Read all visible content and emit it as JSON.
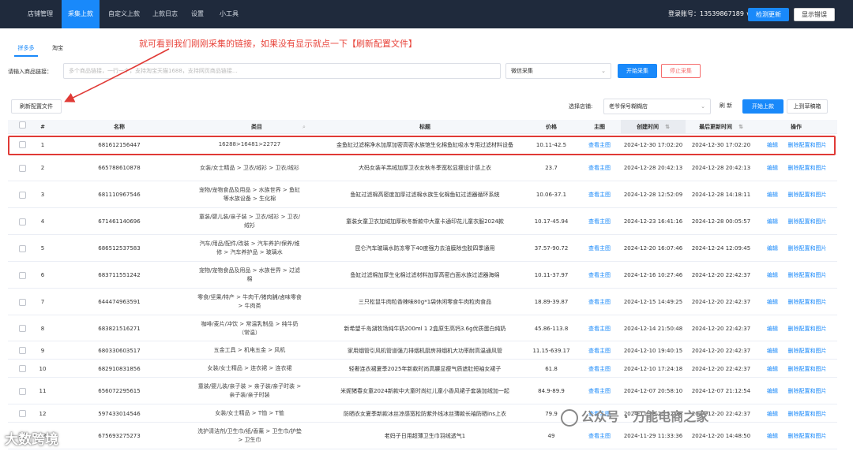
{
  "topnav": {
    "items": [
      "店铺管理",
      "采集上款",
      "自定义上款",
      "上款日志",
      "设置",
      "小工具"
    ],
    "account_label": "登录账号：13539867189 ∨",
    "refresh_btn": "检测更新",
    "login_btn": "显示错误"
  },
  "platform_tabs": [
    "拼多多",
    "淘宝"
  ],
  "annotation": "就可看到我们刚刚采集的链接，如果没有显示就点一下【刷新配置文件】",
  "collect": {
    "label": "请输入商品链接：",
    "placeholder": "多个商品链接，一行一个，支持淘宝天猫1688，支持网页商品链接…",
    "mode": "微信采集",
    "start_btn": "开始采集",
    "stop_btn": "停止采集"
  },
  "toolbar": {
    "refresh_config_btn": "刷新配置文件",
    "store_label": "选择店铺:",
    "store_value": "老爷保号糊糊店",
    "refresh_btn": "刷 新",
    "start_upload_btn": "开始上款",
    "upload_draft_btn": "上到草稿箱"
  },
  "table": {
    "headers": [
      "#",
      "名称",
      "类目",
      "标题",
      "价格",
      "主图",
      "创建时间",
      "最后更新时间",
      "操作"
    ],
    "rows": [
      {
        "no": "1",
        "name": "681612156447",
        "category": "16288>16481>22727",
        "title": "金鱼缸过滤棉净水加厚加密高密水族馆生化棉鱼缸吸水专用过滤材料设备",
        "price": "10.11-42.5",
        "image": "查看主图",
        "created": "2024-12-30 17:02:20",
        "updated": "2024-12-30 17:02:20",
        "edit": "编辑",
        "delete": "删除配置和图片"
      },
      {
        "no": "2",
        "name": "665788610878",
        "category": "女装/女士精品 > 卫衣/绒衫 > 卫衣/绒衫",
        "title": "大码女装羊羔绒加厚卫衣女秋冬季宽松显瘦设计感上衣",
        "price": "23.7",
        "image": "查看主图",
        "created": "2024-12-28 20:42:13",
        "updated": "2024-12-28 20:42:13",
        "edit": "编辑",
        "delete": "删除配置和图片"
      },
      {
        "no": "3",
        "name": "681110967546",
        "category": "宠物/宠物食品及用品 > 水族世界 > 鱼缸等水族设备 > 生化棉",
        "title": "鱼缸过滤棉高密度加厚过滤棉水族生化棉鱼缸过滤器循环系统",
        "price": "10.06-37.1",
        "image": "查看主图",
        "created": "2024-12-28 12:52:09",
        "updated": "2024-12-28 14:18:11",
        "edit": "编辑",
        "delete": "删除配置和图片"
      },
      {
        "no": "4",
        "name": "671461140696",
        "category": "童装/婴儿装/亲子装 > 卫衣/绒衫 > 卫衣/绒衫",
        "title": "童装女童卫衣加绒加厚秋冬新款中大童卡通印花儿童衣服2024款",
        "price": "10.17-45.94",
        "image": "查看主图",
        "created": "2024-12-23 16:41:16",
        "updated": "2024-12-28 00:05:57",
        "edit": "编辑",
        "delete": "删除配置和图片"
      },
      {
        "no": "5",
        "name": "686512537583",
        "category": "汽车/用品/配件/改装 > 汽车养护/保养/维修 > 汽车养护品 > 玻璃水",
        "title": "昆仑汽车玻璃水防冻零下40度强力去油膜除虫胶四季通用",
        "price": "37.57-90.72",
        "image": "查看主图",
        "created": "2024-12-20 16:07:46",
        "updated": "2024-12-24 12:09:45",
        "edit": "编辑",
        "delete": "删除配置和图片"
      },
      {
        "no": "6",
        "name": "683711551242",
        "category": "宠物/宠物食品及用品 > 水族世界 > 过滤棉",
        "title": "鱼缸过滤棉加厚生化棉过滤材料加厚高密白面水族过滤器海绵",
        "price": "10.11-37.97",
        "image": "查看主图",
        "created": "2024-12-16 10:27:46",
        "updated": "2024-12-20 22:42:37",
        "edit": "编辑",
        "delete": "删除配置和图片"
      },
      {
        "no": "7",
        "name": "644474963591",
        "category": "零食/坚果/特产 > 牛肉干/猪肉脯/卤味零食 > 牛肉类",
        "title": "三只松鼠牛肉粒香辣味80g*1袋休闲零食牛肉粒肉食品",
        "price": "18.89-39.87",
        "image": "查看主图",
        "created": "2024-12-15 14:49:25",
        "updated": "2024-12-20 22:42:37",
        "edit": "编辑",
        "delete": "删除配置和图片"
      },
      {
        "no": "8",
        "name": "683821516271",
        "category": "咖啡/麦片/冲饮 > 常温乳制品 > 纯牛奶（常温）",
        "title": "新希望千岛湖牧场纯牛奶200ml 1 2盒原生高钙3.6g优质蛋白纯奶",
        "price": "45.86-113.8",
        "image": "查看主图",
        "created": "2024-12-14 21:50:48",
        "updated": "2024-12-20 22:42:37",
        "edit": "编辑",
        "delete": "删除配置和图片"
      },
      {
        "no": "9",
        "name": "680330603517",
        "category": "五金工具 > 机电五金 > 风机",
        "title": "家用烟管引风机管道强力排烟机厨房排烟机大功率耐高温通风管",
        "price": "11.15-639.17",
        "image": "查看主图",
        "created": "2024-12-10 19:40:15",
        "updated": "2024-12-20 22:42:37",
        "edit": "编辑",
        "delete": "删除配置和图片"
      },
      {
        "no": "10",
        "name": "682910831856",
        "category": "女装/女士精品 > 连衣裙 > 连衣裙",
        "title": "轻奢连衣裙夏季2025年新款时尚高腰显瘦气质遮肚短袖女裙子",
        "price": "61.8",
        "image": "查看主图",
        "created": "2024-12-10 17:24:18",
        "updated": "2024-12-20 22:42:37",
        "edit": "编辑",
        "delete": "删除配置和图片"
      },
      {
        "no": "11",
        "name": "656072295615",
        "category": "童装/婴儿装/亲子装 > 亲子装/亲子时装 > 亲子装/亲子时装",
        "title": "米妮猪春女童2024新款中大童时尚红儿童小香风裙子套装加绒加一起",
        "price": "84.9-89.9",
        "image": "查看主图",
        "created": "2024-12-07 20:58:10",
        "updated": "2024-12-07 21:12:54",
        "edit": "编辑",
        "delete": "删除配置和图片"
      },
      {
        "no": "12",
        "name": "597433014546",
        "category": "女装/女士精品 > T恤 > T恤",
        "title": "防晒衣女夏季新款冰丝凉感宽松防紫外线冰丝薄款长袖防晒ins上衣",
        "price": "79.9",
        "image": "查看主图",
        "created": "2024-11-29 20:52:38",
        "updated": "2024-12-20 22:42:37",
        "edit": "编辑",
        "delete": "删除配置和图片"
      },
      {
        "no": "13",
        "name": "675693275273",
        "category": "洗护清洁剂/卫生巾/纸/香薰 > 卫生巾/护垫 > 卫生巾",
        "title": "老妈子日用超薄卫生巾羽绒透气1",
        "price": "49",
        "image": "查看主图",
        "created": "2024-11-29 11:33:36",
        "updated": "2024-12-20 14:48:50",
        "edit": "编辑",
        "delete": "删除配置和图片"
      }
    ]
  },
  "watermarks": {
    "left": "大数跨境",
    "right": "公众号 · 万能电商之家"
  },
  "colors": {
    "topbar": "#1f2a3c",
    "primary": "#1989fa",
    "annotation_red": "#e8453c",
    "danger": "#f56c6c"
  }
}
